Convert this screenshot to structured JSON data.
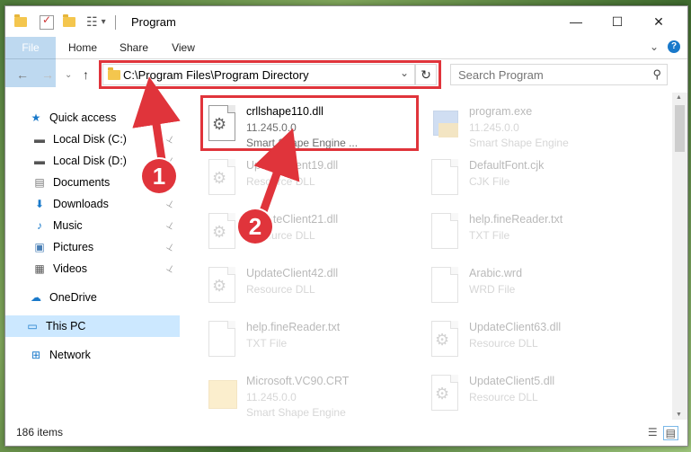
{
  "window": {
    "title": "Program"
  },
  "titlebar": {
    "minimize": "—",
    "maximize": "☐",
    "close": "✕"
  },
  "ribbon": {
    "tabs": [
      "File",
      "Home",
      "Share",
      "View"
    ],
    "expand": "⌄",
    "help": "?"
  },
  "nav": {
    "back": "←",
    "forward": "→",
    "recent": "⌄",
    "up": "↑"
  },
  "address": {
    "path": "C:\\Program Files\\Program Directory",
    "dropdown": "⌄",
    "refresh": "↻"
  },
  "search": {
    "placeholder": "Search Program",
    "icon": "⚲"
  },
  "sidebar": {
    "items": [
      {
        "label": "Quick access",
        "icon": "star-icon",
        "glyph": "★",
        "pinned": false
      },
      {
        "label": "Local Disk (C:)",
        "icon": "drive-icon",
        "glyph": "▬",
        "pinned": true
      },
      {
        "label": "Local Disk (D:)",
        "icon": "drive-icon",
        "glyph": "▬",
        "pinned": true
      },
      {
        "label": "Documents",
        "icon": "documents-icon",
        "glyph": "▤",
        "pinned": true
      },
      {
        "label": "Downloads",
        "icon": "download-icon",
        "glyph": "⬇",
        "pinned": true
      },
      {
        "label": "Music",
        "icon": "music-icon",
        "glyph": "♪",
        "pinned": true
      },
      {
        "label": "Pictures",
        "icon": "pictures-icon",
        "glyph": "▣",
        "pinned": true
      },
      {
        "label": "Videos",
        "icon": "videos-icon",
        "glyph": "▦",
        "pinned": true
      },
      {
        "label": "OneDrive",
        "icon": "cloud-icon",
        "glyph": "☁",
        "pinned": false
      },
      {
        "label": "This PC",
        "icon": "computer-icon",
        "glyph": "▭",
        "pinned": false
      },
      {
        "label": "Network",
        "icon": "network-icon",
        "glyph": "⊞",
        "pinned": false
      }
    ],
    "pin_glyph": "📌"
  },
  "files": [
    {
      "name": "crllshape110.dll",
      "line2": "11.245.0.0",
      "line3": "Smart Shape Engine ...",
      "type": "dll"
    },
    {
      "name": "program.exe",
      "line2": "11.245.0.0",
      "line3": "Smart Shape Engine",
      "type": "exe"
    },
    {
      "name": "UpdateClient19.dll",
      "line2": "Resource DLL",
      "line3": "",
      "type": "dll"
    },
    {
      "name": "DefaultFont.cjk",
      "line2": "CJK File",
      "line3": "",
      "type": "doc"
    },
    {
      "name": "UpdateClient21.dll",
      "line2": "Resource DLL",
      "line3": "",
      "type": "dll"
    },
    {
      "name": "help.fineReader.txt",
      "line2": "TXT File",
      "line3": "",
      "type": "doc"
    },
    {
      "name": "UpdateClient42.dll",
      "line2": "Resource DLL",
      "line3": "",
      "type": "dll"
    },
    {
      "name": "Arabic.wrd",
      "line2": "WRD File",
      "line3": "",
      "type": "doc"
    },
    {
      "name": "help.fineReader.txt",
      "line2": "TXT File",
      "line3": "",
      "type": "doc"
    },
    {
      "name": "UpdateClient63.dll",
      "line2": "Resource DLL",
      "line3": "",
      "type": "dll"
    },
    {
      "name": "Microsoft.VC90.CRT",
      "line2": "11.245.0.0",
      "line3": "Smart Shape Engine",
      "type": "folder"
    },
    {
      "name": "UpdateClient5.dll",
      "line2": "Resource DLL",
      "line3": "",
      "type": "dll"
    }
  ],
  "status": {
    "item_count": "186 items"
  },
  "annotations": {
    "step1": "1",
    "step2": "2",
    "color": "#e0343b"
  }
}
